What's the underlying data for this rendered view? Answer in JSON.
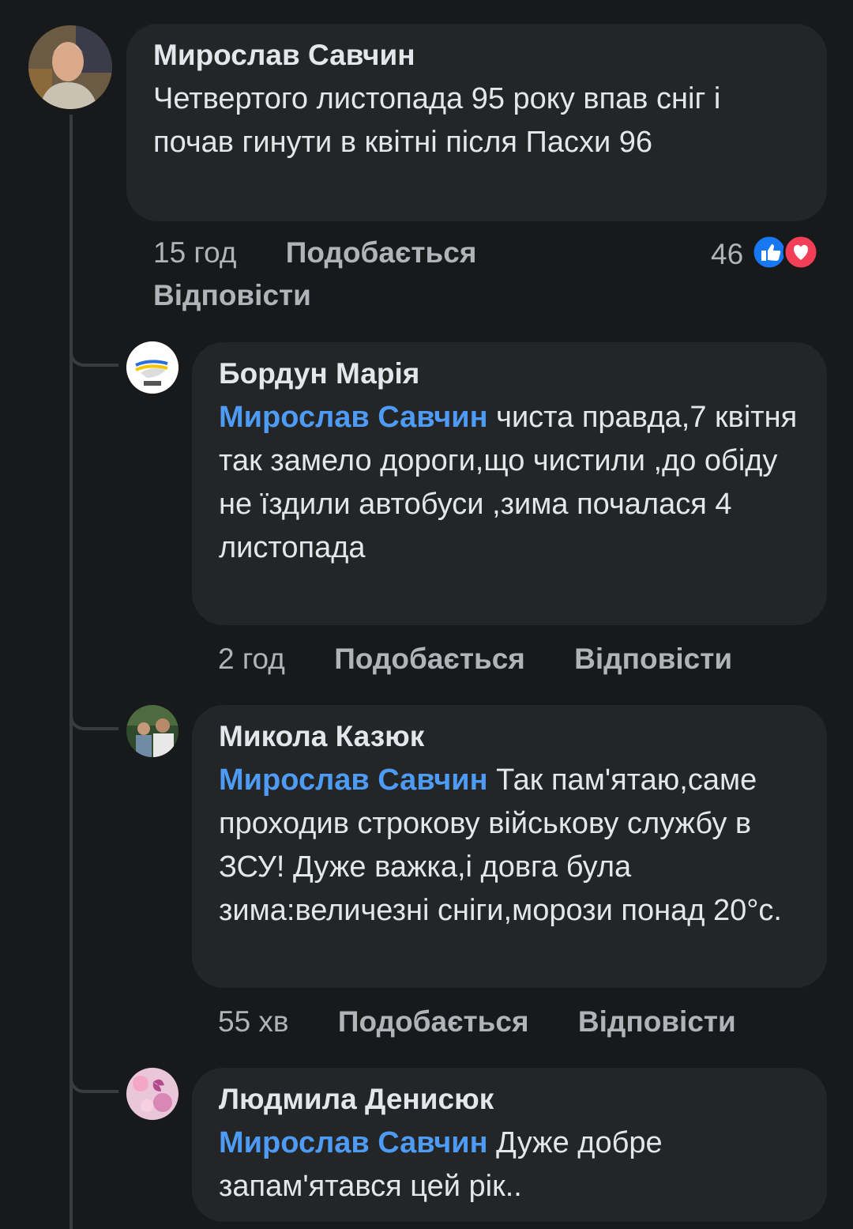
{
  "comments": [
    {
      "author": "Мирослав Савчин",
      "text": "Четвертого листопада 95 року впав сніг і почав гинути в квітні після Пасхи 96",
      "time": "15 год",
      "like_label": "Подобається",
      "reply_label": "Відповісти",
      "reaction_count": "46",
      "reaction_icons": [
        "like-icon",
        "love-icon"
      ]
    },
    {
      "author": "Бордун Марія",
      "mention": "Мирослав Савчин",
      "text": "чиста правда,7 квітня так замело дороги,що чистили ,до обіду не їздили автобуси ,зима почалася 4 листопада",
      "time": "2 год",
      "like_label": "Подобається",
      "reply_label": "Відповісти"
    },
    {
      "author": "Микола Казюк",
      "mention": "Мирослав Савчин",
      "text": "Так пам'ятаю,саме проходив строкову військову службу в ЗСУ! Дуже важка,і довга була зима:величезні сніги,морози понад  20°с.",
      "time": "55 хв",
      "like_label": "Подобається",
      "reply_label": "Відповісти"
    },
    {
      "author": "Людмила Денисюк",
      "mention": "Мирослав Савчин",
      "text": "Дуже добре запам'ятався цей рік.."
    }
  ],
  "colors": {
    "background": "#18191a",
    "bubble": "#242526",
    "mention": "#4e9bf5",
    "meta": "#b0b3b8",
    "like": "#1877f2",
    "love": "#f33e58"
  }
}
